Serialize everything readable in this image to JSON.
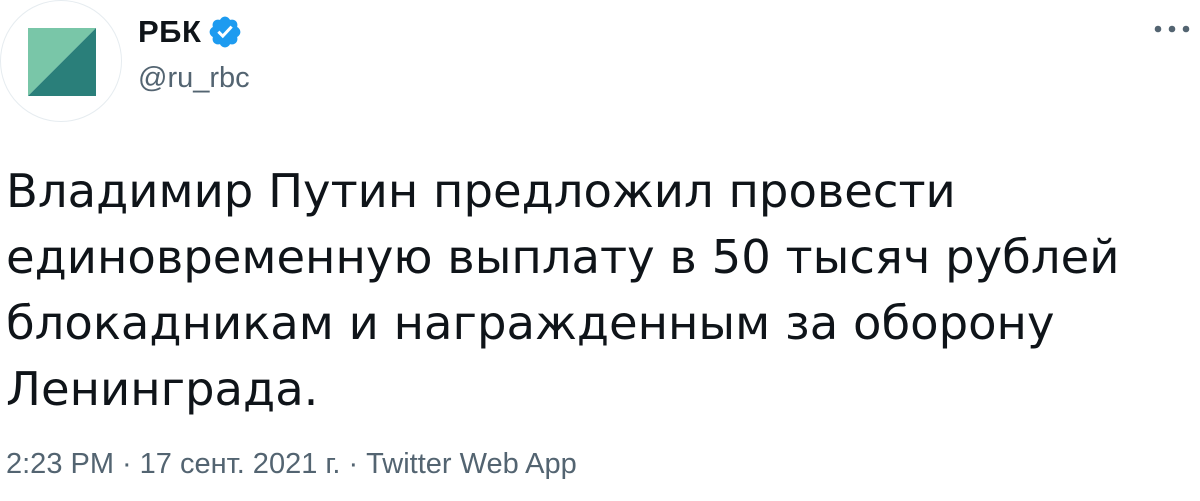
{
  "tweet": {
    "author": {
      "display_name": "РБК",
      "handle": "@ru_rbc",
      "verified": true,
      "avatar_icon": "rbc-logo-icon"
    },
    "text": "Владимир Путин предложил провести\nединовременную выплату в 50 тысяч рублей\nблокадникам и награжденным за оборону\nЛенинграда.",
    "meta": {
      "time": "2:23 PM",
      "separator": "·",
      "date": "17 сент. 2021 г.",
      "source": "Twitter Web App"
    },
    "more_icon": "more-horizontal-icon"
  },
  "colors": {
    "text_primary": "#0f1419",
    "text_secondary": "#536471",
    "verified_blue": "#1d9bf0",
    "logo_light": "#79c6a8",
    "logo_dark": "#2a7f7a"
  }
}
